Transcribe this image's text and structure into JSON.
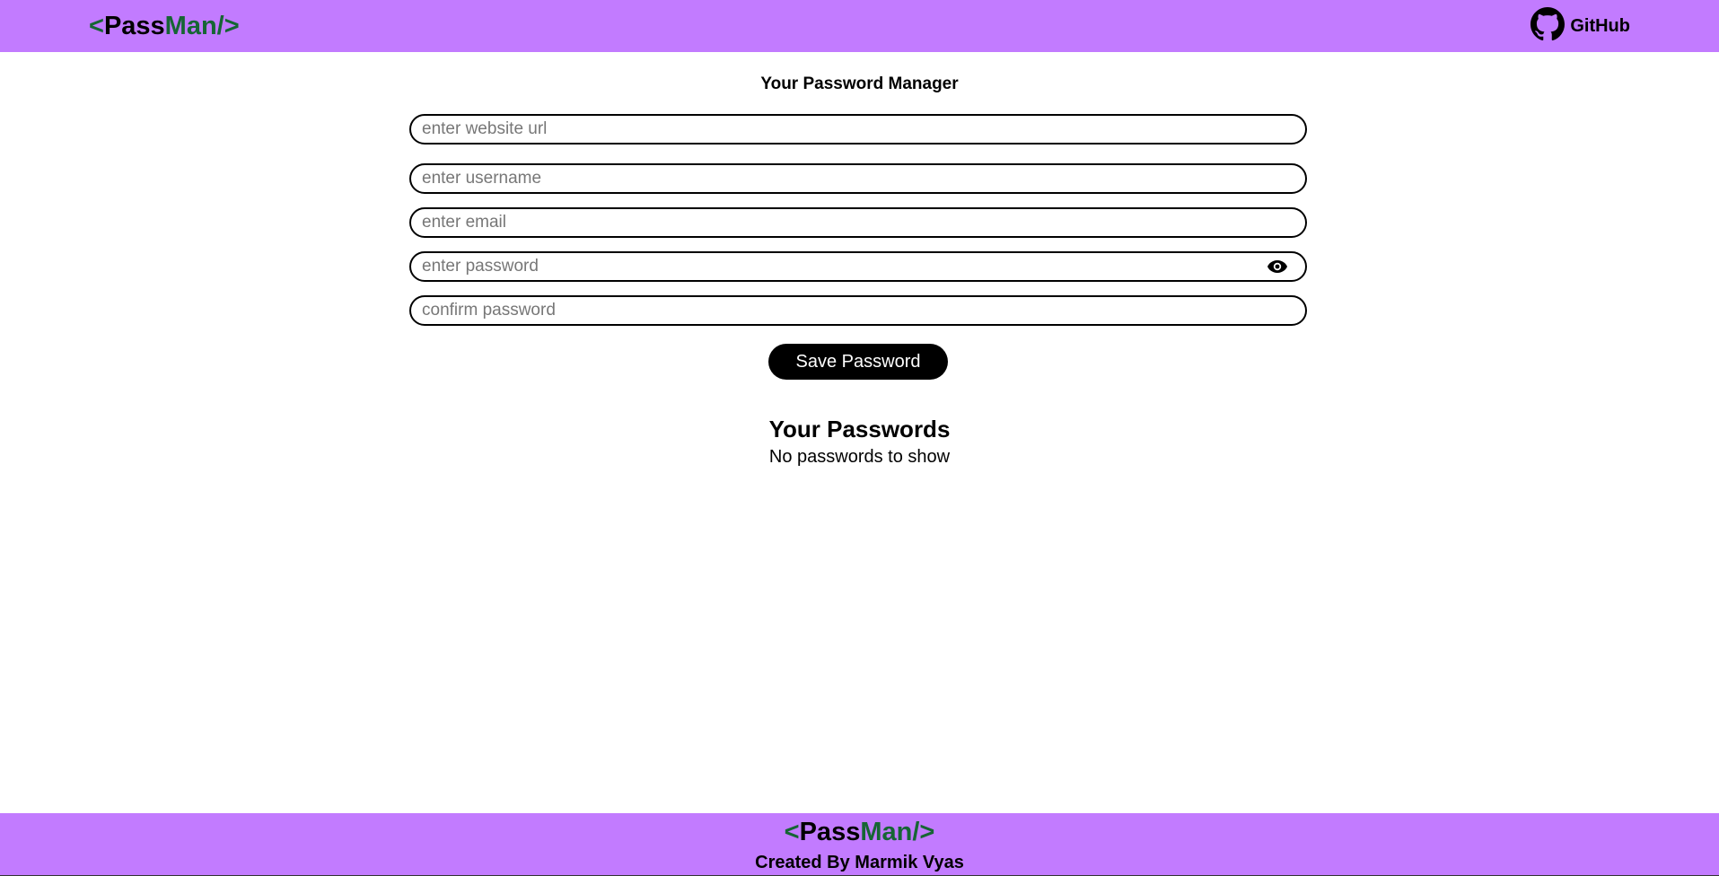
{
  "brand": {
    "open": "<",
    "pass": "Pass",
    "man": "Man/",
    "close": ">"
  },
  "nav": {
    "github_label": "GitHub",
    "github_icon": "github-icon"
  },
  "main": {
    "title": "Your Password Manager",
    "fields": {
      "website_placeholder": "enter website url",
      "website_value": "",
      "username_placeholder": "enter username",
      "username_value": "",
      "email_placeholder": "enter email",
      "email_value": "",
      "password_placeholder": "enter password",
      "password_value": "",
      "confirm_placeholder": "confirm password",
      "confirm_value": ""
    },
    "password_toggle_icon": "eye-icon",
    "save_label": "Save Password"
  },
  "passwords": {
    "title": "Your Passwords",
    "empty_text": "No passwords to show"
  },
  "footer": {
    "credit": "Created By Marmik Vyas"
  },
  "colors": {
    "bar_background": "#c27bff",
    "brand_green": "#166534",
    "button_background": "#000000",
    "button_text": "#ffffff"
  }
}
